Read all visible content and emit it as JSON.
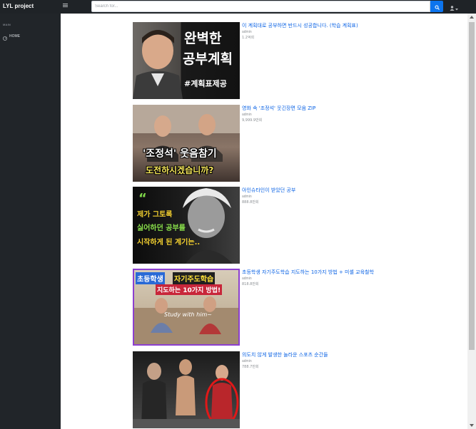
{
  "app": {
    "brand": "LYL project"
  },
  "search": {
    "placeholder": "Search for..."
  },
  "sidebar": {
    "heading": "MAIN",
    "items": [
      {
        "label": "HOME",
        "icon": "gauge-icon"
      }
    ]
  },
  "colors": {
    "topbar": "#1f2327",
    "sidebar": "#212529",
    "accent": "#0c74ee",
    "link": "#0b63e5",
    "muted": "#8b8f93"
  },
  "videos": [
    {
      "title": "이 계획대로 공부하면 반드시 성공합니다. (학습 계획표)",
      "author": "admin",
      "views": "1.2억회",
      "thumb_text": [
        "완벽한",
        "공부계획",
        "#계획표제공"
      ]
    },
    {
      "title": "영화 속 '조정석' 웃긴장면 모음 ZIP",
      "author": "admin",
      "views": "9,999.9만회",
      "thumb_text": [
        "'조정석' 웃음참기",
        "도전하시겠습니까?"
      ]
    },
    {
      "title": "아인슈타인이 받았던 공부",
      "author": "admin",
      "views": "888.8만회",
      "thumb_text": [
        "“",
        "제가 그토록",
        "싫어하던 공부를",
        "시작하게 된 계기는.."
      ]
    },
    {
      "title": "초등학생 자기주도학습 지도하는 10가지 방법 + 미셸 교육철학",
      "author": "admin",
      "views": "818.8만회",
      "thumb_text": [
        "초등학생",
        "자기주도학습",
        "지도하는 10가지 방법!",
        "Study with him~"
      ]
    },
    {
      "title": "의도치 않게 발생한 놀라운 스포츠 순간들",
      "author": "admin",
      "views": "788.7만회",
      "thumb_text": []
    }
  ]
}
